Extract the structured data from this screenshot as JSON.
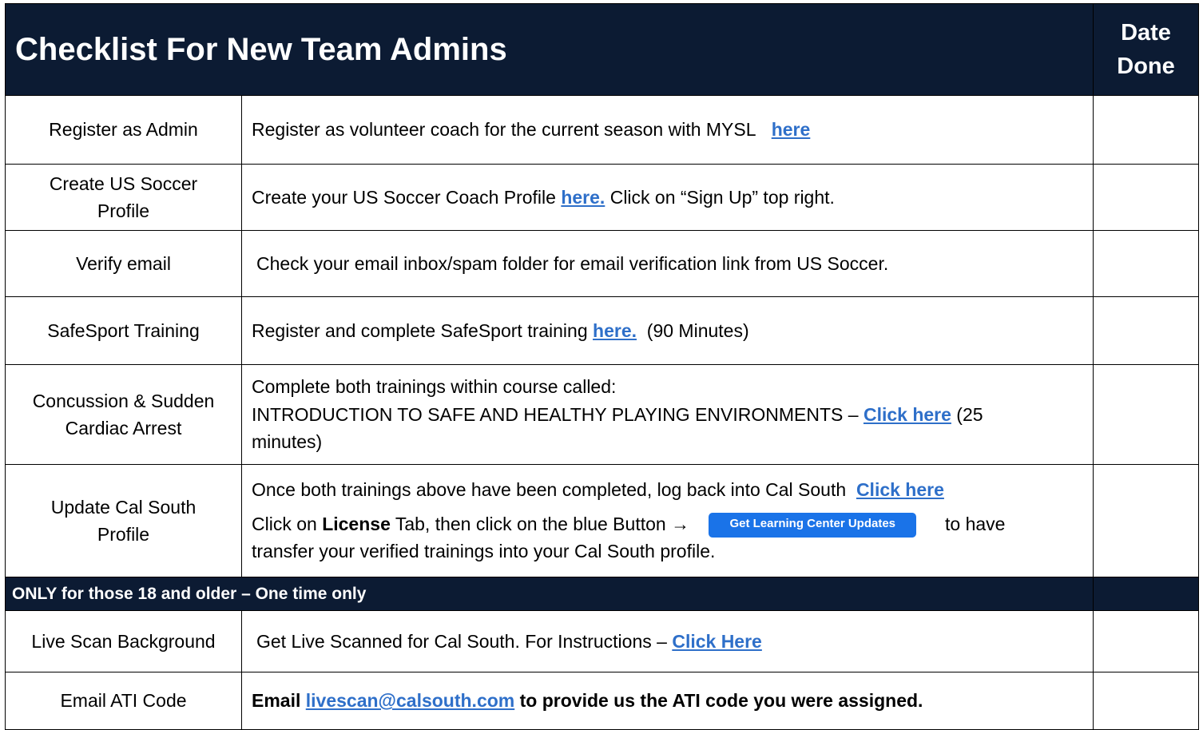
{
  "header": {
    "title": "Checklist For New Team Admins",
    "date_line1": "Date",
    "date_line2": "Done"
  },
  "rows": [
    {
      "label": "Register as Admin",
      "text": "Register as volunteer coach for the current season with MYSL",
      "link": "here"
    },
    {
      "label_line1": "Create US Soccer",
      "label_line2": "Profile",
      "text_before": "Create your US Soccer Coach Profile",
      "link": "here.",
      "text_after": "Click on “Sign Up” top right."
    },
    {
      "label": "Verify email",
      "text": "Check your email inbox/spam folder for email verification link from US Soccer."
    },
    {
      "label": "SafeSport Training",
      "text_before": "Register and complete SafeSport training",
      "link": "here.",
      "text_after": "(90 Minutes)"
    },
    {
      "label_line1": "Concussion & Sudden",
      "label_line2": "Cardiac Arrest",
      "line1": "Complete both trainings within course called:",
      "line2_before": "INTRODUCTION TO SAFE AND HEALTHY PLAYING ENVIRONMENTS –",
      "link": "Click here",
      "line2_after": "(25",
      "line3": "minutes)"
    },
    {
      "label_line1": "Update Cal South",
      "label_line2": "Profile",
      "line1": "Once both trainings above have been completed, log back into Cal South",
      "link": "Click here",
      "line2_before": "Click on",
      "line2_bold": "License",
      "line2_mid": "Tab, then click on the blue Button →",
      "button_label": "Get Learning Center Updates",
      "line2_after": "to have",
      "line3": "transfer your verified trainings into your Cal South profile."
    }
  ],
  "section": {
    "label": "ONLY for those 18 and older – One time only"
  },
  "rows2": [
    {
      "label": "Live Scan Background",
      "text": "Get Live Scanned for Cal South. For Instructions –",
      "link": "Click Here"
    },
    {
      "label": "Email ATI Code",
      "bold_before": "Email",
      "link": "livescan@calsouth.com",
      "bold_after": "to provide us the ATI code you were assigned."
    }
  ],
  "colors": {
    "header_bg": "#0c1b33",
    "link": "#2e6fc9",
    "button": "#1a73e8"
  }
}
